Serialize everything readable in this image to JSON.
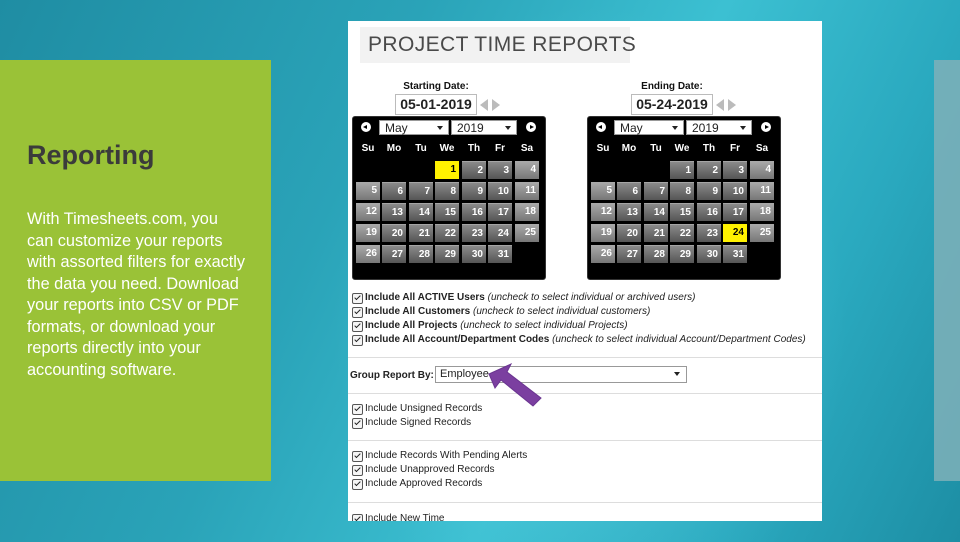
{
  "slide": {
    "heading": "Reporting",
    "body": "With Timesheets.com, you can customize your reports with assorted filters for exactly the data you need. Download your reports into CSV or PDF formats, or download your reports directly into your accounting software."
  },
  "report": {
    "title": "PROJECT TIME REPORTS",
    "start": {
      "label": "Starting Date:",
      "value": "05-01-2019",
      "month": "May",
      "year": "2019",
      "highlight": 1
    },
    "end": {
      "label": "Ending Date:",
      "value": "05-24-2019",
      "month": "May",
      "year": "2019",
      "highlight": 24
    },
    "weekdays": [
      "Su",
      "Mo",
      "Tu",
      "We",
      "Th",
      "Fr",
      "Sa"
    ],
    "include_all": [
      {
        "bold": "Include All ACTIVE Users",
        "note": "(uncheck to select individual or archived users)"
      },
      {
        "bold": "Include All Customers",
        "note": "(uncheck to select individual customers)"
      },
      {
        "bold": "Include All Projects",
        "note": "(uncheck to select individual Projects)"
      },
      {
        "bold": "Include All Account/Department Codes",
        "note": "(uncheck to select individual Account/Department Codes)"
      }
    ],
    "group_by": {
      "label": "Group Report By:",
      "value": "Employee"
    },
    "records_signed": [
      "Include Unsigned Records",
      "Include Signed Records"
    ],
    "records_approval": [
      "Include Records With Pending Alerts",
      "Include Unapproved Records",
      "Include Approved Records"
    ],
    "records_time": [
      "Include New Time"
    ]
  },
  "colors": {
    "green_panel": "#9ac237",
    "highlight": "#fff200",
    "pointer_arrow": "#7b3fa0"
  }
}
